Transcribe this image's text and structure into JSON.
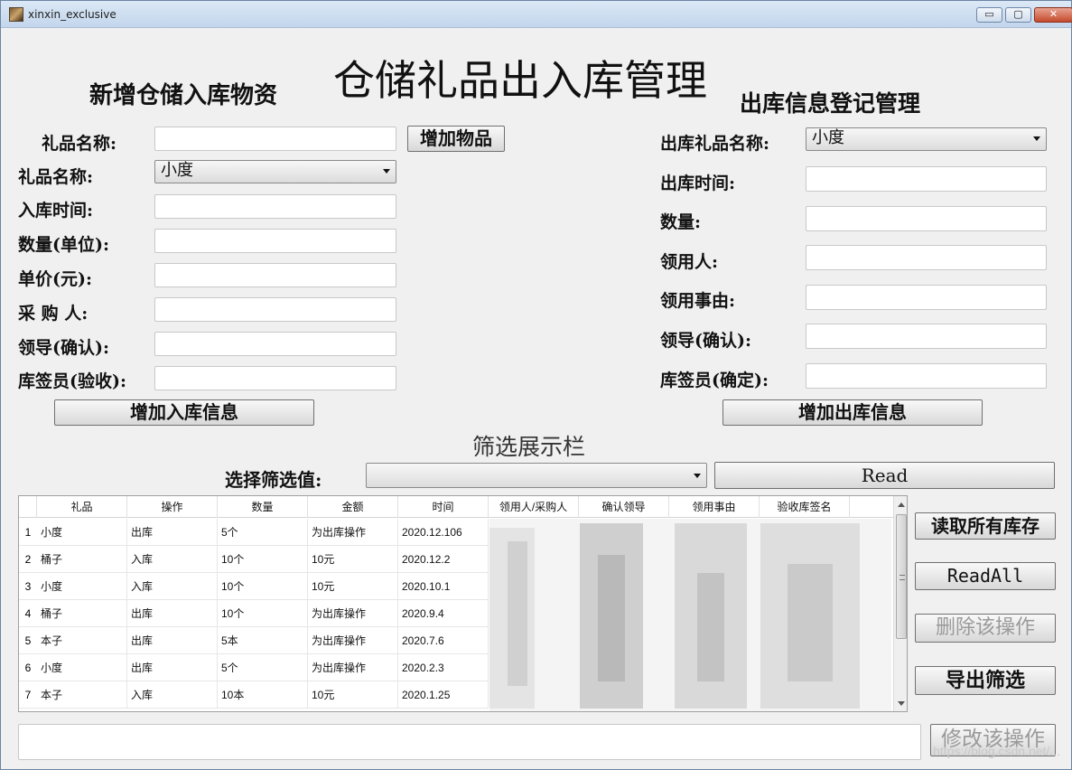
{
  "window": {
    "title": "xinxin_exclusive",
    "controls": {
      "minimize": "▭",
      "maximize": "▢",
      "close": "✕"
    }
  },
  "headings": {
    "main": "仓储礼品出入库管理",
    "inbound": "新增仓储入库物资",
    "outbound": "出库信息登记管理",
    "filter": "筛选展示栏"
  },
  "inbound": {
    "gift_name_label": "礼品名称:",
    "gift_name_value": "",
    "add_item_button": "增加物品",
    "gift_select_label": "礼品名称:",
    "gift_select_value": "小度",
    "time_label": "入库时间:",
    "quantity_label": "数量(单位):",
    "price_label": "单价(元):",
    "buyer_label": "采 购 人:",
    "leader_label": "领导(确认):",
    "keeper_label": "库签员(验收):",
    "submit_button": "增加入库信息"
  },
  "outbound": {
    "gift_label": "出库礼品名称:",
    "gift_value": "小度",
    "time_label": "出库时间:",
    "quantity_label": "数量:",
    "receiver_label": "领用人:",
    "reason_label": "领用事由:",
    "leader_label": "领导(确认):",
    "keeper_label": "库签员(确定):",
    "submit_button": "增加出库信息"
  },
  "filter": {
    "select_label": "选择筛选值:",
    "select_value": "",
    "read_button": "Read"
  },
  "table": {
    "columns": [
      "礼品",
      "操作",
      "数量",
      "金额",
      "时间",
      "领用人/采购人",
      "确认领导",
      "领用事由",
      "验收库签名"
    ],
    "rows": [
      {
        "n": "1",
        "cells": [
          "小度",
          "出库",
          "5个",
          "为出库操作",
          "2020.12.106"
        ]
      },
      {
        "n": "2",
        "cells": [
          "桶子",
          "入库",
          "10个",
          "10元",
          "2020.12.2"
        ]
      },
      {
        "n": "3",
        "cells": [
          "小度",
          "入库",
          "10个",
          "10元",
          "2020.10.1"
        ]
      },
      {
        "n": "4",
        "cells": [
          "桶子",
          "出库",
          "10个",
          "为出库操作",
          "2020.9.4"
        ]
      },
      {
        "n": "5",
        "cells": [
          "本子",
          "出库",
          "5本",
          "为出库操作",
          "2020.7.6"
        ]
      },
      {
        "n": "6",
        "cells": [
          "小度",
          "出库",
          "5个",
          "为出库操作",
          "2020.2.3"
        ]
      },
      {
        "n": "7",
        "cells": [
          "本子",
          "入库",
          "10本",
          "10元",
          "2020.1.25"
        ]
      }
    ]
  },
  "side_buttons": {
    "read_all_stock": "读取所有库存",
    "read_all": "ReadAll",
    "delete_op": "删除该操作",
    "export_filter": "导出筛选",
    "modify_op": "修改该操作"
  },
  "bottom_input": {
    "value": ""
  },
  "watermark": "https://blog.csdn.net/..."
}
